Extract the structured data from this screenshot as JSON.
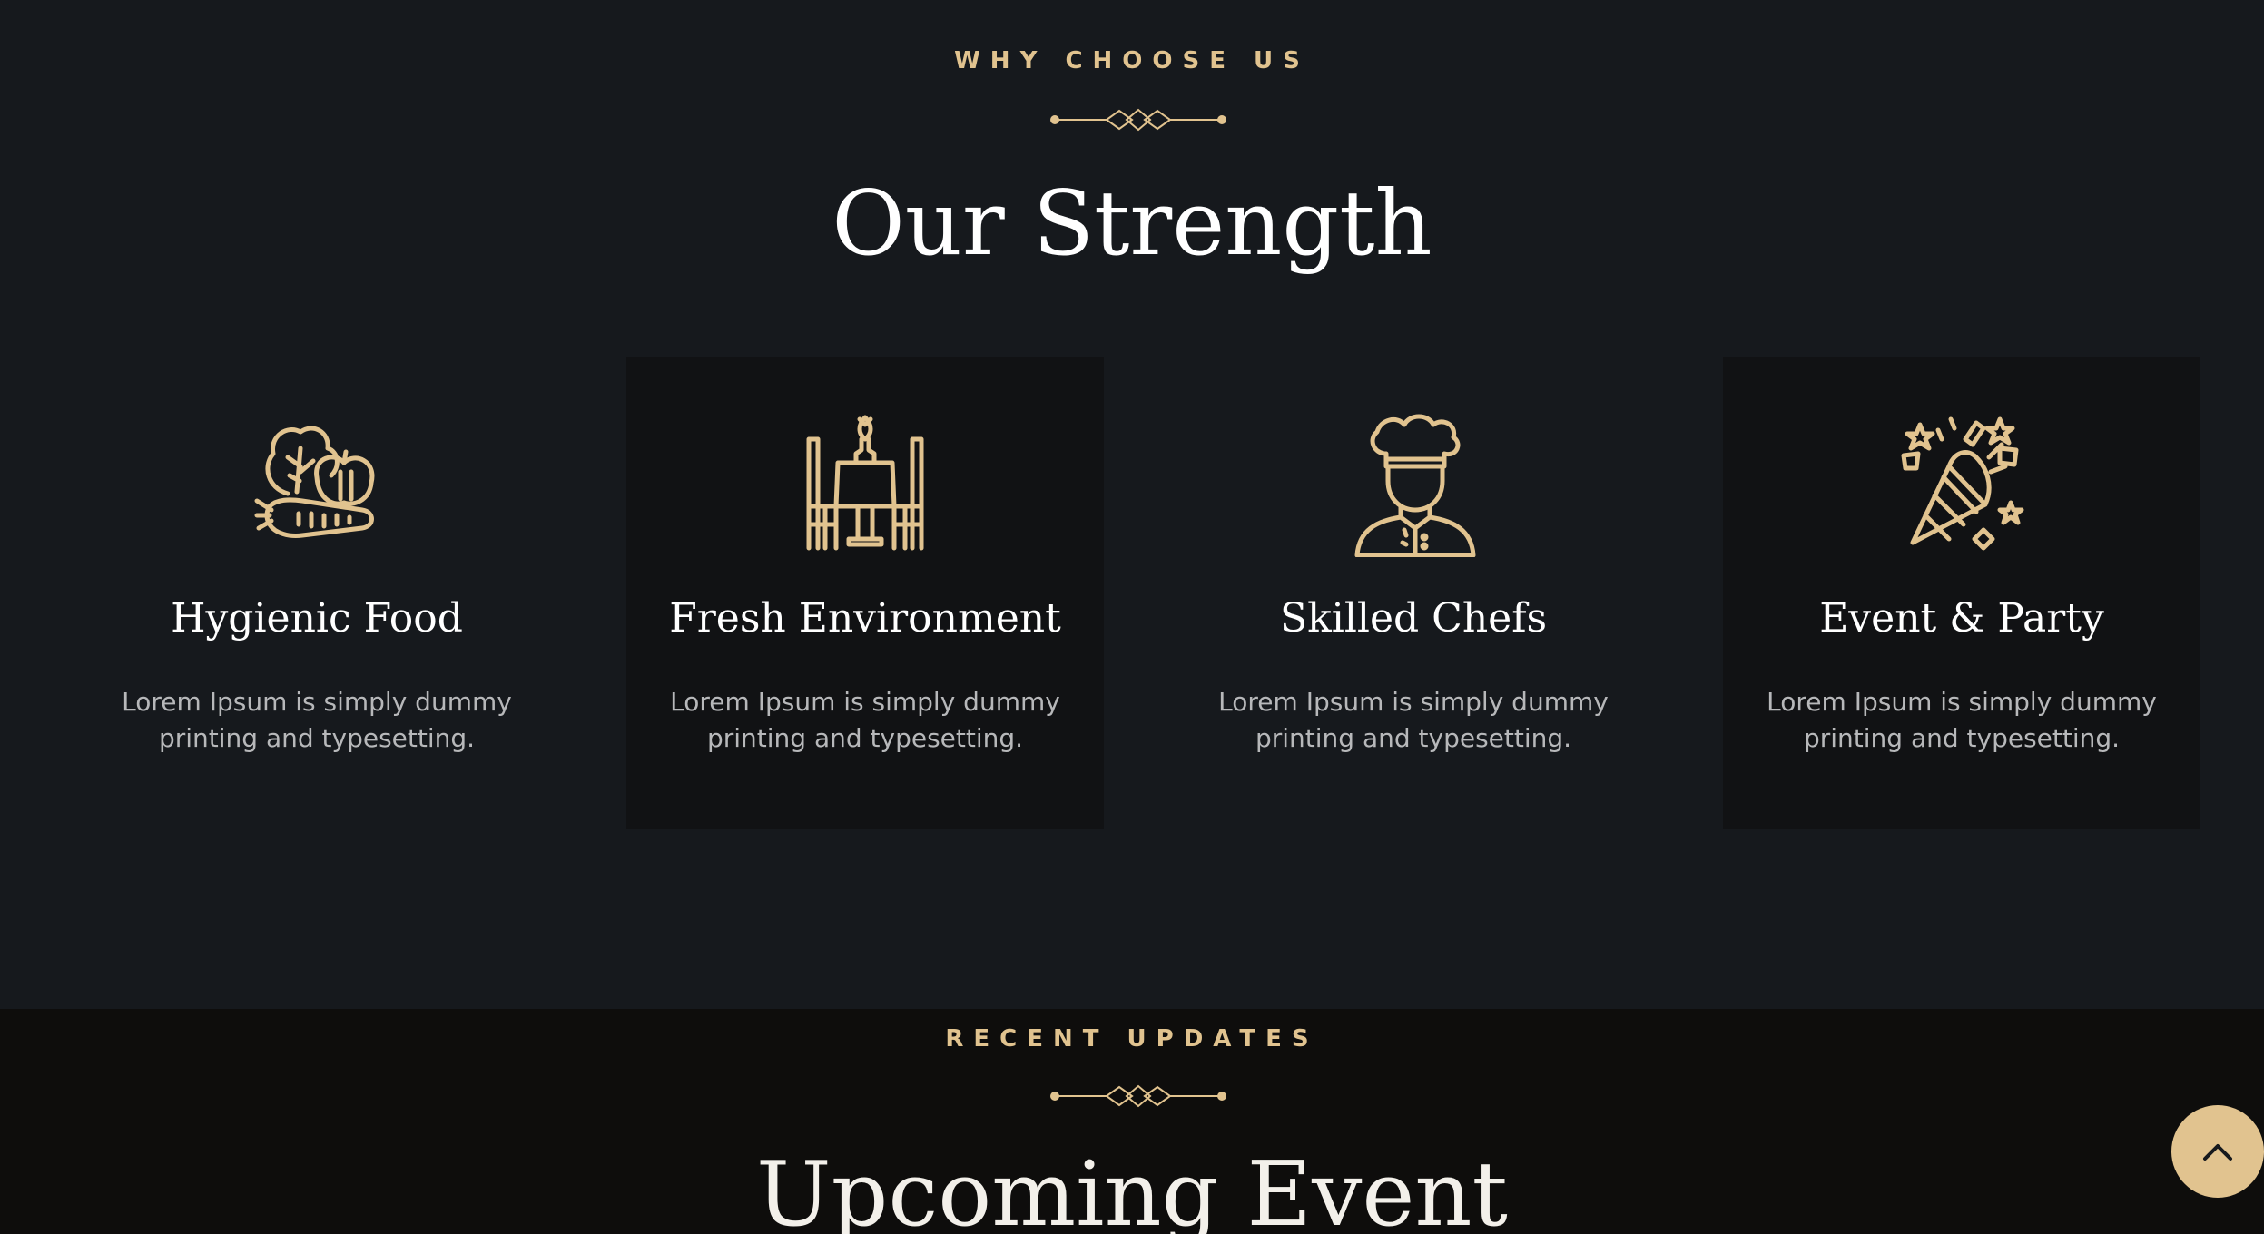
{
  "strength_section": {
    "eyebrow": "WHY CHOOSE US",
    "heading": "Our Strength",
    "cards": [
      {
        "icon": "vegetables-icon",
        "title": "Hygienic Food",
        "desc_line1": "Lorem Ipsum is simply dummy",
        "desc_line2": "printing and typesetting."
      },
      {
        "icon": "dining-table-icon",
        "title": "Fresh Environment",
        "desc_line1": "Lorem Ipsum is simply dummy",
        "desc_line2": "printing and typesetting."
      },
      {
        "icon": "chef-icon",
        "title": "Skilled Chefs",
        "desc_line1": "Lorem Ipsum is simply dummy",
        "desc_line2": "printing and typesetting."
      },
      {
        "icon": "party-popper-icon",
        "title": "Event & Party",
        "desc_line1": "Lorem Ipsum is simply dummy",
        "desc_line2": "printing and typesetting."
      }
    ]
  },
  "updates_section": {
    "eyebrow": "RECENT UPDATES",
    "heading": "Upcoming Event"
  },
  "scroll_top": {
    "icon": "chevron-up-icon"
  },
  "colors": {
    "accent": "#e1c38f",
    "background": "#16191d",
    "card_alt": "#111214",
    "footer_band": "#0e0d0c"
  }
}
